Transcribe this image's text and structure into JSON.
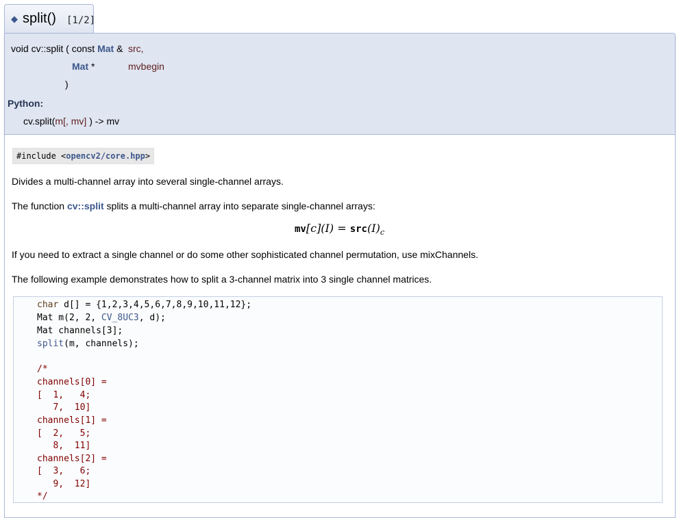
{
  "title": {
    "bullet": "◆",
    "name": "split()",
    "overload": "[1/2]"
  },
  "prototype": {
    "return_and_name": "void cv::split",
    "open_paren": "(",
    "const_kw": "const",
    "param1_type": "Mat",
    "param1_ref": "&",
    "param1_name": "src,",
    "param2_type": "Mat",
    "param2_ptr": "*",
    "param2_name": "mvbegin",
    "close_paren": ")"
  },
  "python": {
    "label": "Python:",
    "call_prefix": "cv.split(",
    "call_args": "m[, mv]",
    "call_suffix": ") -> mv"
  },
  "include": {
    "prefix": "#include <",
    "header": "opencv2/core.hpp",
    "suffix": ">"
  },
  "paragraphs": {
    "p1": "Divides a multi-channel array into several single-channel arrays.",
    "p2_before": "The function",
    "p2_link": "cv::split",
    "p2_after": "splits a multi-channel array into separate single-channel arrays:",
    "p3": "If you need to extract a single channel or do some other sophisticated channel permutation, use mixChannels.",
    "p4": "The following example demonstrates how to split a 3-channel matrix into 3 single channel matrices."
  },
  "formula": {
    "lhs_bold": "mv",
    "lhs_index": "[c](I)",
    "equals": "=",
    "rhs_bold": "src",
    "rhs_arg": "(I)",
    "rhs_sub": "c"
  },
  "code": {
    "l1_type": "char",
    "l1_rest": " d[] = {1,2,3,4,5,6,7,8,9,10,11,12};",
    "l2_a": "Mat m(2, 2, ",
    "l2_link": "CV_8UC3",
    "l2_b": ", d);",
    "l3": "Mat channels[3];",
    "l4_link": "split",
    "l4_rest": "(m, channels);",
    "comment": [
      "/*",
      "channels[0] =",
      "[  1,   4;",
      "   7,  10]",
      "channels[1] =",
      "[  2,   5;",
      "   8,  11]",
      "channels[2] =",
      "[  3,   6;",
      "   9,  12]",
      "*/"
    ]
  }
}
